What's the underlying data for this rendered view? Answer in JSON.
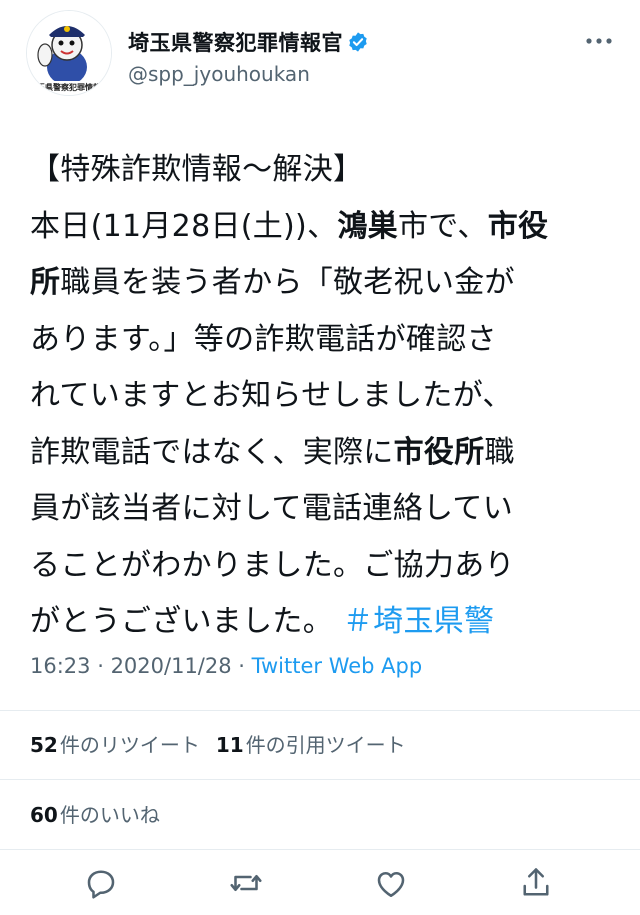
{
  "account": {
    "display_name": "埼玉県警察犯罪情報官",
    "handle": "@spp_jyouhoukan",
    "avatar_caption": "埼玉県警察犯罪情報官"
  },
  "tweet": {
    "line1": "【特殊詐欺情報～解決】",
    "line2a": "本日(11月28日(土))、",
    "line2b": "鴻巣",
    "line2c": "市で、",
    "line2d": "市役",
    "line3a": "所",
    "line3b": "職員を装う者から「敬老祝い金が",
    "line4": "あります。」等の詐欺電話が確認さ",
    "line5": "れていますとお知らせしましたが、",
    "line6a": "詐欺電話ではなく、実際に",
    "line6b": "市役所",
    "line6c": "職",
    "line7": "員が該当者に対して電話連絡してい",
    "line8": "ることがわかりました。ご協力あり",
    "line9": "がとうございました。",
    "hashtag": "＃埼玉県警"
  },
  "meta": {
    "time": "16:23",
    "sep1": " · ",
    "date": "2020/11/28",
    "sep2": " · ",
    "source": "Twitter Web App"
  },
  "stats": {
    "retweets_count": "52",
    "retweets_label": "件のリツイート",
    "quotes_count": "11",
    "quotes_label": "件の引用ツイート",
    "likes_count": "60",
    "likes_label": "件のいいね"
  },
  "colors": {
    "text": "#0f1419",
    "secondary": "#536471",
    "link": "#1d9bf0",
    "divider": "#e6ecf0"
  },
  "icons": [
    "verified-badge-icon",
    "more-icon",
    "reply-icon",
    "retweet-icon",
    "like-icon",
    "share-icon"
  ]
}
